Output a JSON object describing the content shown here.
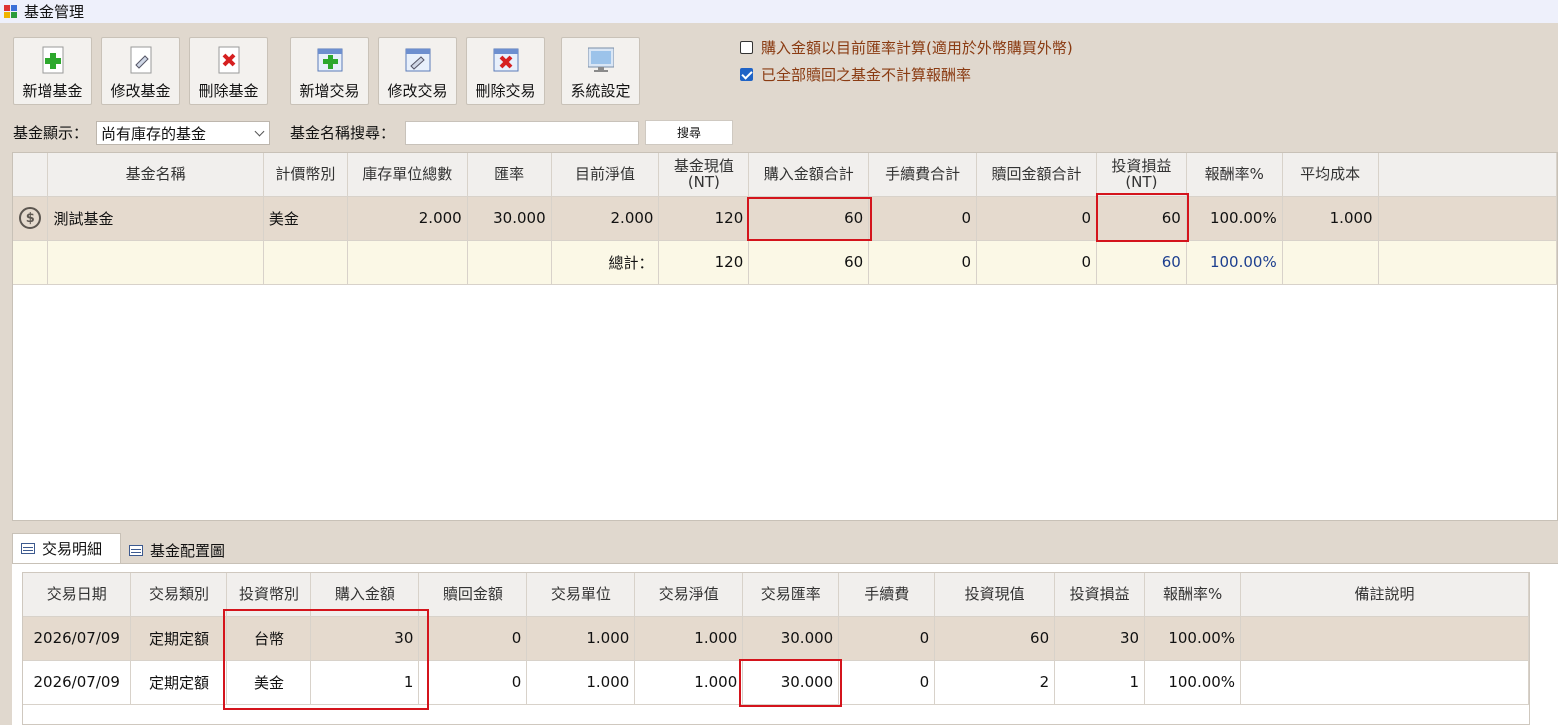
{
  "window": {
    "title": "基金管理"
  },
  "toolbar": {
    "add_fund": "新增基金",
    "edit_fund": "修改基金",
    "delete_fund": "刪除基金",
    "add_trade": "新增交易",
    "edit_trade": "修改交易",
    "delete_trade": "刪除交易",
    "settings": "系統設定"
  },
  "options": {
    "opt1": {
      "label": "購入金額以目前匯率計算(適用於外幣購買外幣)",
      "checked": false
    },
    "opt2": {
      "label": "已全部贖回之基金不計算報酬率",
      "checked": true
    }
  },
  "filter": {
    "display_label": "基金顯示：",
    "display_value": "尚有庫存的基金",
    "search_label": "基金名稱搜尋：",
    "search_value": "",
    "search_button": "搜尋"
  },
  "fund_grid": {
    "headers": [
      "基金名稱",
      "計價幣別",
      "庫存單位總數",
      "匯率",
      "目前淨值",
      "基金現值\n(NT)",
      "購入金額合計",
      "手續費合計",
      "贖回金額合計",
      "投資損益\n(NT)",
      "報酬率%",
      "平均成本"
    ],
    "rows": [
      {
        "icon": "fund-coin-icon",
        "name": "測試基金",
        "currency": "美金",
        "units": "2.000",
        "rate": "30.000",
        "nav": "2.000",
        "value": "120",
        "bought": "60",
        "fee": "0",
        "redeemed": "0",
        "pnl": "60",
        "roi": "100.00%",
        "avg_cost": "1.000"
      }
    ],
    "total": {
      "label": "總計：",
      "value": "120",
      "bought": "60",
      "fee": "0",
      "redeemed": "0",
      "pnl": "60",
      "roi": "100.00%"
    }
  },
  "tabs": {
    "detail": "交易明細",
    "allocation": "基金配置圖"
  },
  "trade_grid": {
    "headers": [
      "交易日期",
      "交易類別",
      "投資幣別",
      "購入金額",
      "贖回金額",
      "交易單位",
      "交易淨值",
      "交易匯率",
      "手續費",
      "投資現值",
      "投資損益",
      "報酬率%",
      "備註說明"
    ],
    "rows": [
      [
        "2026/07/09",
        "定期定額",
        "台幣",
        "30",
        "0",
        "1.000",
        "1.000",
        "30.000",
        "0",
        "60",
        "30",
        "100.00%",
        ""
      ],
      [
        "2026/07/09",
        "定期定額",
        "美金",
        "1",
        "0",
        "1.000",
        "1.000",
        "30.000",
        "0",
        "2",
        "1",
        "100.00%",
        ""
      ]
    ]
  },
  "colors": {
    "highlight": "#d4141c",
    "accent_text": "#8a3b12",
    "link_blue": "#1d3f8f"
  }
}
